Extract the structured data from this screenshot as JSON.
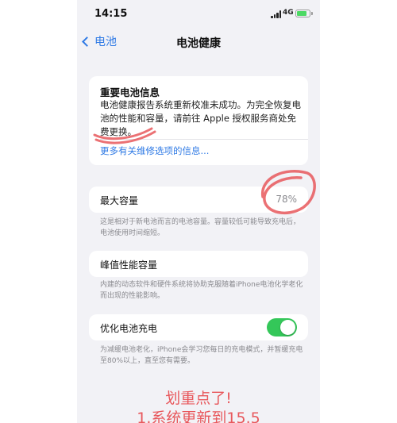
{
  "status_bar": {
    "time": "14:15",
    "network": "4G",
    "battery_level": 0.8
  },
  "nav": {
    "back_label": "电池",
    "title": "电池健康"
  },
  "info_card": {
    "title": "重要电池信息",
    "body": "电池健康报告系统重新校准未成功。为完全恢复电池的性能和容量，请前往 Apple 授权服务商处免费更换。",
    "link": "更多有关维修选项的信息..."
  },
  "capacity": {
    "label": "最大容量",
    "value": "78%",
    "footnote": "这是相对于新电池而言的电池容量。容量较低可能导致充电后，电池使用时间缩短。"
  },
  "peak": {
    "label": "峰值性能容量",
    "footnote": "内建的动态软件和硬件系统将协助克服随着iPhone电池化学老化而出现的性能影响。"
  },
  "optimized": {
    "label": "优化电池充电",
    "enabled": true,
    "footnote": "为减缓电池老化，iPhone会学习您每日的充电模式，并暂缓充电至80%以上，直至您有需要。"
  },
  "overlay": {
    "line1": "划重点了!",
    "line2": "1.系统更新到15.5"
  },
  "colors": {
    "accent": "#2f7ae5",
    "toggle_on": "#34c759",
    "annotation": "#e8585c",
    "background": "#f2f2f6"
  }
}
